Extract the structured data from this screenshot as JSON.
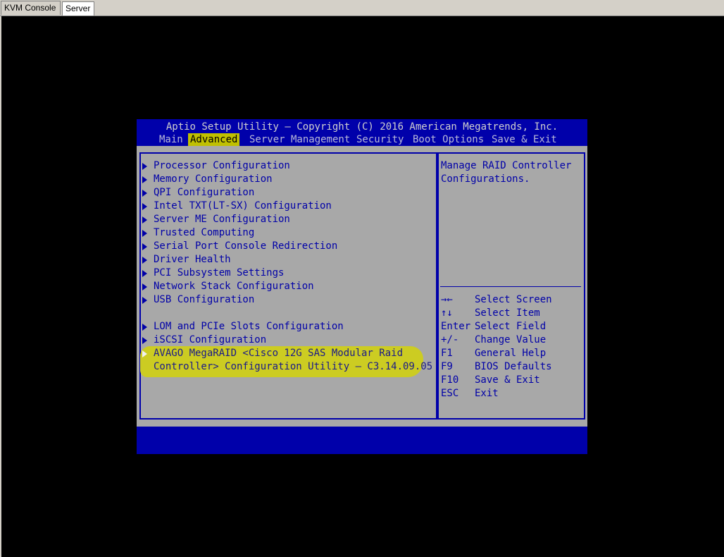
{
  "tabs": [
    {
      "label": "KVM Console"
    },
    {
      "label": "Server"
    }
  ],
  "bios": {
    "title": "Aptio Setup Utility – Copyright (C) 2016 American Megatrends, Inc.",
    "menu": [
      {
        "label": "Main",
        "active": false
      },
      {
        "label": "Advanced",
        "active": true
      },
      {
        "label": "Server Management",
        "active": false
      },
      {
        "label": "Security",
        "active": false
      },
      {
        "label": "Boot Options",
        "active": false
      },
      {
        "label": "Save & Exit",
        "active": false
      }
    ],
    "items": [
      {
        "label": "Processor Configuration"
      },
      {
        "label": "Memory Configuration"
      },
      {
        "label": "QPI Configuration"
      },
      {
        "label": "Intel TXT(LT-SX) Configuration"
      },
      {
        "label": "Server ME Configuration"
      },
      {
        "label": "Trusted Computing"
      },
      {
        "label": "Serial Port Console Redirection"
      },
      {
        "label": "Driver Health"
      },
      {
        "label": "PCI Subsystem Settings"
      },
      {
        "label": "Network Stack Configuration"
      },
      {
        "label": "USB Configuration"
      },
      {
        "label": "LOM and PCIe Slots Configuration"
      },
      {
        "label": "iSCSI Configuration"
      },
      {
        "label": "AVAGO MegaRAID <Cisco 12G SAS Modular Raid",
        "continuation": "Controller> Configuration Utility – C3.14.09.05",
        "highlighted": true
      }
    ],
    "help": {
      "line1": "Manage RAID Controller",
      "line2": "Configurations."
    },
    "keys": [
      {
        "key": "→←",
        "action": "Select Screen"
      },
      {
        "key": "↑↓",
        "action": "Select Item"
      },
      {
        "key": "Enter",
        "action": "Select Field"
      },
      {
        "key": "+/-",
        "action": "Change Value"
      },
      {
        "key": "F1",
        "action": "General Help"
      },
      {
        "key": "F9",
        "action": "BIOS Defaults"
      },
      {
        "key": "F10",
        "action": "Save & Exit"
      },
      {
        "key": "ESC",
        "action": "Exit"
      }
    ],
    "colors": {
      "blue": "#0000aa",
      "grey": "#a8a8a8",
      "highlight": "#c0c000",
      "text": "#0000a8"
    }
  }
}
